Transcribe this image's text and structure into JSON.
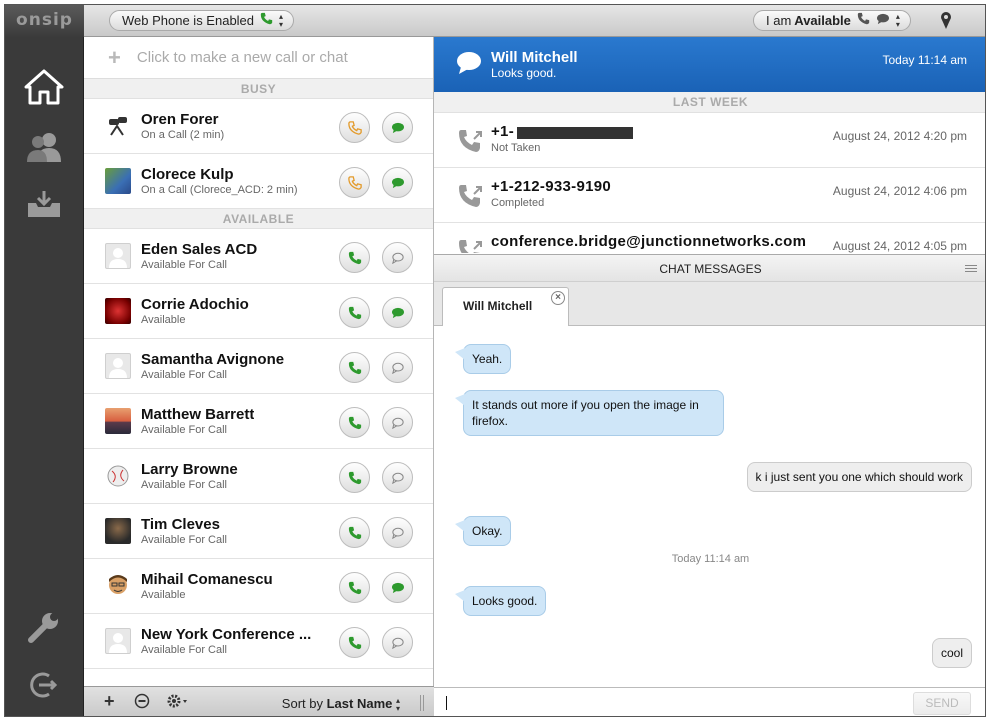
{
  "app": {
    "logo": "onsip"
  },
  "topbar": {
    "phone_status": "Web Phone is Enabled",
    "presence_prefix": "I am",
    "presence_value": "Available"
  },
  "sidebar": {
    "items": [
      {
        "name": "home-icon"
      },
      {
        "name": "contacts-icon"
      },
      {
        "name": "inbox-icon"
      },
      {
        "name": "wrench-icon"
      },
      {
        "name": "logout-icon"
      }
    ]
  },
  "contacts": {
    "new_call_placeholder": "Click to make a new call or chat",
    "sections": [
      {
        "title": "BUSY"
      },
      {
        "title": "AVAILABLE"
      }
    ],
    "busy": [
      {
        "name": "Oren Forer",
        "status": "On a Call (2 min)"
      },
      {
        "name": "Clorece Kulp",
        "status": "On a Call (Clorece_ACD: 2 min)"
      }
    ],
    "available": [
      {
        "name": "Eden Sales ACD",
        "status": "Available For Call"
      },
      {
        "name": "Corrie Adochio",
        "status": "Available"
      },
      {
        "name": "Samantha Avignone",
        "status": "Available For Call"
      },
      {
        "name": "Matthew Barrett",
        "status": "Available For Call"
      },
      {
        "name": "Larry Browne",
        "status": "Available For Call"
      },
      {
        "name": "Tim Cleves",
        "status": "Available For Call"
      },
      {
        "name": "Mihail Comanescu",
        "status": "Available"
      },
      {
        "name": "New York Conference ...",
        "status": "Available For Call"
      }
    ],
    "footer": {
      "sort_prefix": "Sort by",
      "sort_value": "Last Name"
    }
  },
  "active_chat": {
    "name": "Will Mitchell",
    "last_message": "Looks good.",
    "time": "Today 11:14 am"
  },
  "history": {
    "section": "LAST WEEK",
    "items": [
      {
        "number": "+1-",
        "status": "Not Taken",
        "time": "August 24, 2012 4:20 pm"
      },
      {
        "number": "+1-212-933-9190",
        "status": "Completed",
        "time": "August 24, 2012 4:06 pm"
      },
      {
        "number": "conference.bridge@junctionnetworks.com",
        "status": "",
        "time": "August 24, 2012 4:05 pm"
      }
    ]
  },
  "chat": {
    "header": "CHAT MESSAGES",
    "tab": "Will Mitchell",
    "messages": [
      {
        "dir": "in",
        "text": "Yeah."
      },
      {
        "dir": "in",
        "text": "It stands out more if you open the image in firefox."
      },
      {
        "dir": "out",
        "text": "k i just sent you one which should work"
      },
      {
        "dir": "in",
        "text": "Okay."
      },
      {
        "dir": "in",
        "text": "Looks good."
      },
      {
        "dir": "out",
        "text": "cool"
      }
    ],
    "timestamp": "Today 11:14 am",
    "send_label": "SEND"
  },
  "colors": {
    "accent": "#1f6bc0",
    "call_green": "#2e9a2e",
    "busy_orange": "#e39b2c"
  }
}
